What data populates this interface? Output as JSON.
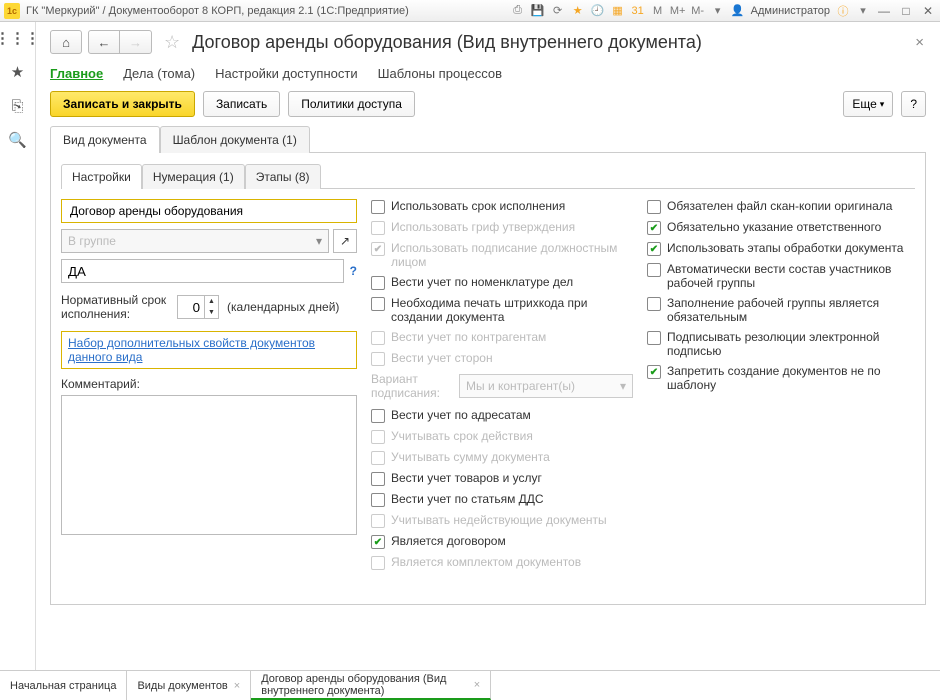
{
  "titlebar": {
    "logo": "1c",
    "title": "ГК \"Меркурий\" / Документооборот 8 КОРП, редакция 2.1  (1С:Предприятие)",
    "user_label": "Администратор",
    "badges": [
      "M",
      "M+",
      "M-"
    ]
  },
  "page": {
    "title": "Договор аренды оборудования (Вид внутреннего документа)"
  },
  "section_tabs": [
    "Главное",
    "Дела (тома)",
    "Настройки доступности",
    "Шаблоны процессов"
  ],
  "cmdbar": {
    "save_close": "Записать и закрыть",
    "save": "Записать",
    "access": "Политики доступа",
    "more": "Еще",
    "help": "?"
  },
  "top_tabs": [
    "Вид документа",
    "Шаблон документа (1)"
  ],
  "inner_tabs": [
    "Настройки",
    "Нумерация (1)",
    "Этапы (8)"
  ],
  "form": {
    "name_value": "Договор аренды оборудования",
    "group_placeholder": "В группе",
    "index_value": "ДА",
    "norm_label": "Нормативный срок исполнения:",
    "norm_value": "0",
    "norm_unit": "(календарных дней)",
    "extra_props_link": "Набор дополнительных свойств документов данного вида",
    "comment_label": "Комментарий:"
  },
  "mid_checks": [
    {
      "label": "Использовать срок исполнения",
      "checked": false,
      "disabled": false
    },
    {
      "label": "Использовать гриф утверждения",
      "checked": false,
      "disabled": true
    },
    {
      "label": "Использовать подписание должностным лицом",
      "checked": true,
      "disabled": true
    },
    {
      "label": "Вести учет по номенклатуре дел",
      "checked": false,
      "disabled": false
    },
    {
      "label": "Необходима печать штрихкода при создании документа",
      "checked": false,
      "disabled": false
    },
    {
      "label": "Вести учет по контрагентам",
      "checked": false,
      "disabled": true
    },
    {
      "label": "Вести учет сторон",
      "checked": false,
      "disabled": true
    }
  ],
  "variant": {
    "label": "Вариант подписания:",
    "value": "Мы и контрагент(ы)"
  },
  "mid_checks2": [
    {
      "label": "Вести учет по адресатам",
      "checked": false,
      "disabled": false
    },
    {
      "label": "Учитывать срок действия",
      "checked": false,
      "disabled": true
    },
    {
      "label": "Учитывать сумму документа",
      "checked": false,
      "disabled": true
    },
    {
      "label": "Вести учет товаров и услуг",
      "checked": false,
      "disabled": false
    },
    {
      "label": "Вести учет по статьям ДДС",
      "checked": false,
      "disabled": false
    },
    {
      "label": "Учитывать недействующие документы",
      "checked": false,
      "disabled": true
    },
    {
      "label": "Является договором",
      "checked": true,
      "disabled": false
    },
    {
      "label": "Является комплектом документов",
      "checked": false,
      "disabled": true
    }
  ],
  "right_checks": [
    {
      "label": "Обязателен файл скан-копии оригинала",
      "checked": false,
      "disabled": false
    },
    {
      "label": "Обязательно указание ответственного",
      "checked": true,
      "disabled": false
    },
    {
      "label": "Использовать этапы обработки документа",
      "checked": true,
      "disabled": false
    },
    {
      "label": "Автоматически вести состав участников рабочей группы",
      "checked": false,
      "disabled": false
    },
    {
      "label": "Заполнение рабочей группы является обязательным",
      "checked": false,
      "disabled": false
    },
    {
      "label": "Подписывать резолюции электронной подписью",
      "checked": false,
      "disabled": false
    },
    {
      "label": "Запретить создание документов не по шаблону",
      "checked": true,
      "disabled": false
    }
  ],
  "doc_tabs": [
    {
      "label": "Начальная страница",
      "closable": false,
      "active": false
    },
    {
      "label": "Виды документов",
      "closable": true,
      "active": false
    },
    {
      "label": "Договор аренды оборудования (Вид внутреннего документа)",
      "closable": true,
      "active": true
    }
  ]
}
